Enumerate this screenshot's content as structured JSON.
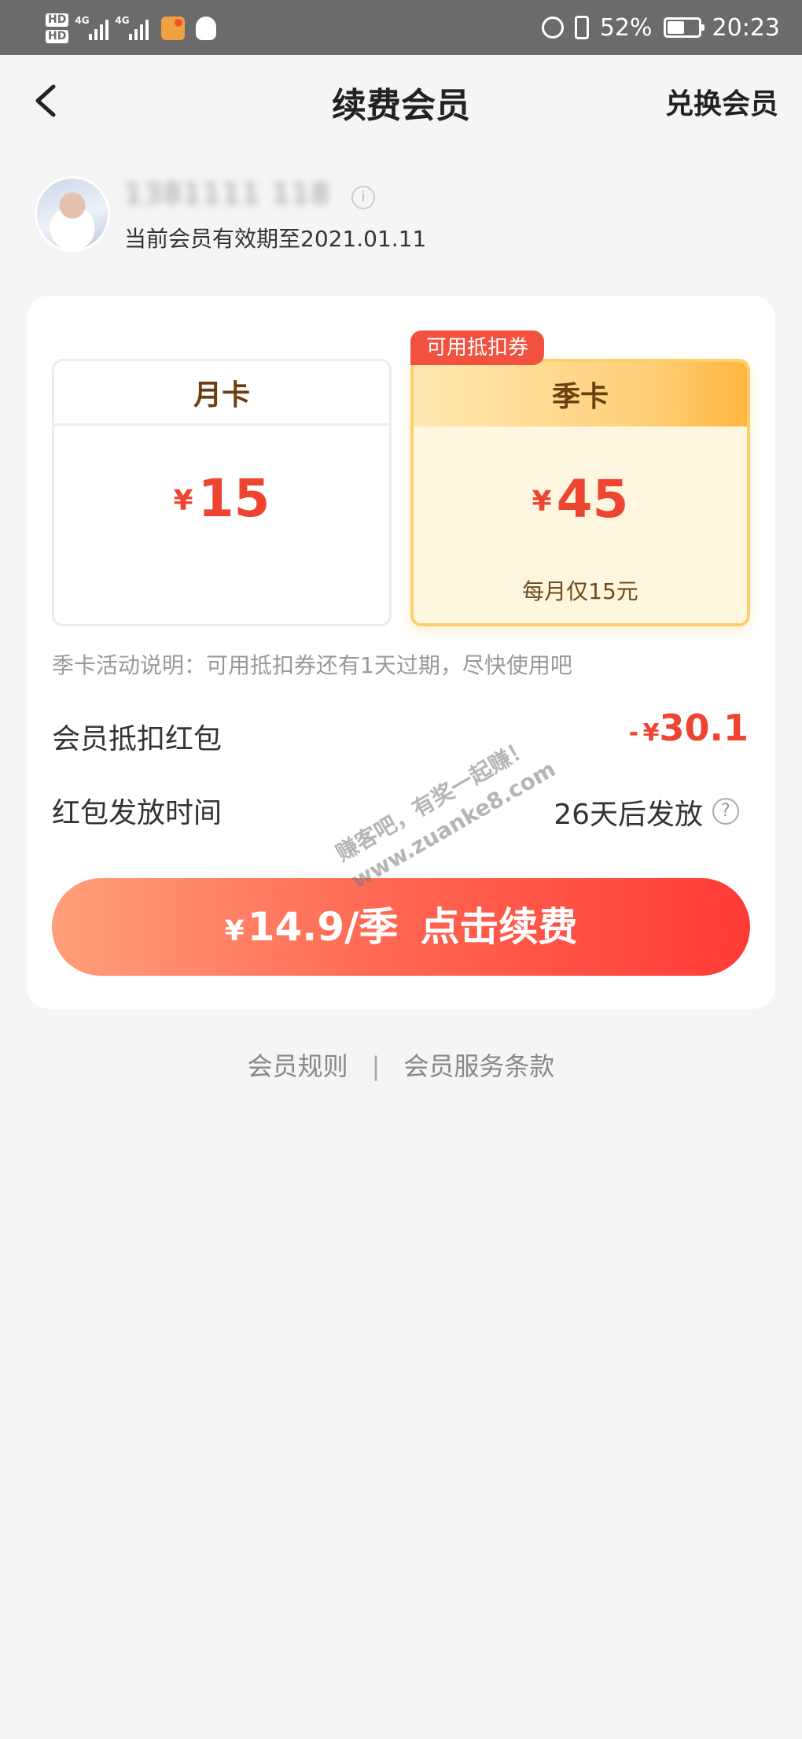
{
  "status_bar": {
    "hd1": "HD",
    "hd2": "HD",
    "net1": "4G",
    "net2": "4G",
    "battery_percent": "52%",
    "battery_level": 0.52,
    "time": "20:23"
  },
  "nav": {
    "title": "续费会员",
    "right_action": "兑换会员"
  },
  "user": {
    "name_masked": "1381111 118",
    "info_icon": "i",
    "expiry_text": "当前会员有效期至2021.01.11"
  },
  "plans": [
    {
      "name": "月卡",
      "currency": "¥",
      "price": "15",
      "note": ""
    },
    {
      "name": "季卡",
      "currency": "¥",
      "price": "45",
      "note": "每月仅15元",
      "tag": "可用抵扣券"
    }
  ],
  "activity_note": "季卡活动说明：可用抵扣券还有1天过期，尽快使用吧",
  "deduction": {
    "label": "会员抵扣红包",
    "minus": "-",
    "currency": "¥",
    "amount": "30.1"
  },
  "release": {
    "label": "红包发放时间",
    "value": "26天后发放",
    "help_icon": "?"
  },
  "pay_button": {
    "currency": "¥",
    "price_text": "14.9/季",
    "action_text": "点击续费"
  },
  "watermark": {
    "line1": "赚客吧，有奖一起赚！",
    "line2": "www.zuanke8.com"
  },
  "footer": {
    "rules": "会员规则",
    "separator": "|",
    "terms": "会员服务条款"
  },
  "colors": {
    "accent": "#ee4432",
    "gold": "#fbd06a",
    "status_bar": "#6b6b6b",
    "background": "#f5f5f5"
  }
}
